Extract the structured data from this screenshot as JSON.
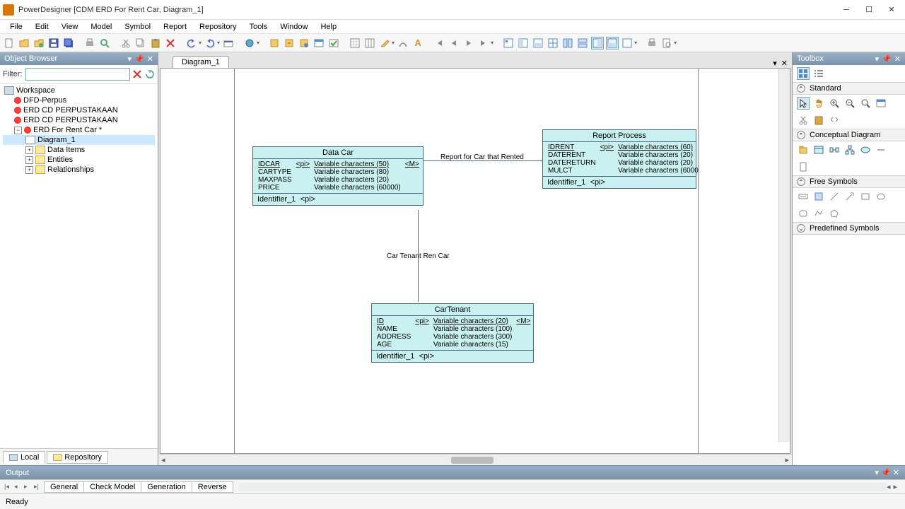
{
  "title": "PowerDesigner [CDM ERD For Rent Car, Diagram_1]",
  "menu": [
    "File",
    "Edit",
    "View",
    "Model",
    "Symbol",
    "Report",
    "Repository",
    "Tools",
    "Window",
    "Help"
  ],
  "object_browser": {
    "title": "Object Browser",
    "filter_label": "Filter:",
    "filter_value": "",
    "tree": {
      "workspace": "Workspace",
      "models": [
        "DFD-Perpus",
        "ERD CD PERPUSTAKAAN",
        "ERD CD PERPUSTAKAAN",
        "ERD For Rent Car *"
      ],
      "diagram": "Diagram_1",
      "folders": [
        "Data Items",
        "Entities",
        "Relationships"
      ]
    },
    "tabs": {
      "local": "Local",
      "repository": "Repository"
    }
  },
  "canvas": {
    "tab": "Diagram_1",
    "entities": {
      "data_car": {
        "title": "Data Car",
        "rows": [
          {
            "name": "IDCAR",
            "pi": "<pi>",
            "type": "Variable characters (50)",
            "m": "<M>",
            "pk": true
          },
          {
            "name": "CARTYPE",
            "pi": "",
            "type": "Variable characters (80)",
            "m": "",
            "pk": false
          },
          {
            "name": "MAXPASS",
            "pi": "",
            "type": "Variable characters (20)",
            "m": "",
            "pk": false
          },
          {
            "name": "PRICE",
            "pi": "",
            "type": "Variable characters (60000)",
            "m": "",
            "pk": false
          }
        ],
        "identifier": "Identifier_1",
        "identifier_pi": "<pi>"
      },
      "report_process": {
        "title": "Report Process",
        "rows": [
          {
            "name": "IDRENT",
            "pi": "<pi>",
            "type": "Variable characters (60)",
            "m": "",
            "pk": true
          },
          {
            "name": "DATERENT",
            "pi": "",
            "type": "Variable characters (20)",
            "m": "",
            "pk": false
          },
          {
            "name": "DATERETURN",
            "pi": "",
            "type": "Variable characters (20)",
            "m": "",
            "pk": false
          },
          {
            "name": "MULCT",
            "pi": "",
            "type": "Variable characters (6000",
            "m": "",
            "pk": false
          }
        ],
        "identifier": "Identifier_1",
        "identifier_pi": "<pi>"
      },
      "car_tenant": {
        "title": "CarTenant",
        "rows": [
          {
            "name": "ID",
            "pi": "<pi>",
            "type": "Variable characters (20)",
            "m": "<M>",
            "pk": true
          },
          {
            "name": "NAME",
            "pi": "",
            "type": "Variable characters (100)",
            "m": "",
            "pk": false
          },
          {
            "name": "ADDRESS",
            "pi": "",
            "type": "Variable characters (300)",
            "m": "",
            "pk": false
          },
          {
            "name": "AGE",
            "pi": "",
            "type": "Variable characters (15)",
            "m": "",
            "pk": false
          }
        ],
        "identifier": "Identifier_1",
        "identifier_pi": "<pi>"
      }
    },
    "relationships": {
      "r1": "Report for Car that Rented",
      "r2": "Car Tenant Ren Car"
    }
  },
  "toolbox": {
    "title": "Toolbox",
    "sections": {
      "standard": "Standard",
      "conceptual": "Conceptual Diagram",
      "free": "Free Symbols",
      "predefined": "Predefined Symbols"
    }
  },
  "output": {
    "title": "Output",
    "tabs": [
      "General",
      "Check Model",
      "Generation",
      "Reverse"
    ]
  },
  "status": "Ready"
}
